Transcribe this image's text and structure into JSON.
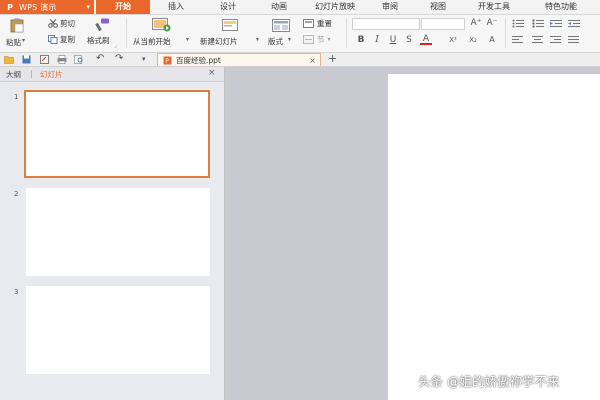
{
  "app": {
    "logo": "P",
    "name": "WPS 演示",
    "caret": "▾"
  },
  "menu_tabs": [
    {
      "label": "开始",
      "active": true
    },
    {
      "label": "插入"
    },
    {
      "label": "设计"
    },
    {
      "label": "动画"
    },
    {
      "label": "幻灯片放映"
    },
    {
      "label": "审阅"
    },
    {
      "label": "视图"
    },
    {
      "label": "开发工具"
    },
    {
      "label": "特色功能"
    }
  ],
  "ribbon": {
    "paste": "粘贴",
    "paste_caret": "▾",
    "cut": "剪切",
    "copy": "复制",
    "format_painter": "格式刷",
    "from_current": "从当前开始",
    "new_slide": "新建幻灯片",
    "layout": "版式",
    "reset": "重置",
    "section": "节",
    "bold": "B",
    "italic": "I",
    "underline": "U",
    "strike": "S",
    "font_color": "A",
    "superscript": "X²",
    "subscript": "X₂",
    "grow_font": "A⁺",
    "shrink_font": "A⁻",
    "caret": "▾",
    "dialog_launcher": "⌟"
  },
  "quick_access": {
    "undo": "↶",
    "redo": "↷",
    "dropdown": "▾"
  },
  "document_tab": {
    "filename": "百度经验.ppt",
    "close": "×",
    "add": "+"
  },
  "panel": {
    "tab_outline": "大纲",
    "tab_divider": "|",
    "tab_slides": "幻灯片",
    "close": "×",
    "slides": [
      {
        "number": "1",
        "selected": true
      },
      {
        "number": "2"
      },
      {
        "number": "3"
      }
    ]
  },
  "watermark": "头条 @姐的娇傲祢学不来",
  "colors": {
    "accent": "#e9672a",
    "selected_border": "#d9803f"
  }
}
